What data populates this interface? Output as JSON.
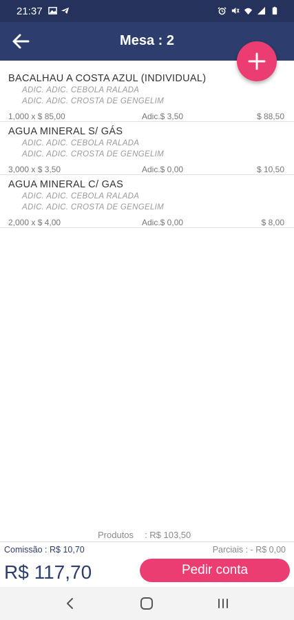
{
  "status_bar": {
    "time": "21:37",
    "left_icons": [
      "gallery-icon",
      "telegram-icon"
    ],
    "right_icons": [
      "alarm-icon",
      "mute-icon",
      "wifi-icon",
      "signal-icon",
      "battery-icon"
    ]
  },
  "app_bar": {
    "title": "Mesa : 2",
    "back_icon": "arrow-left-icon",
    "add_icon": "plus-icon"
  },
  "items": [
    {
      "name": "BACALHAU A COSTA AZUL (INDIVIDUAL)",
      "additions": [
        "ADIC. ADIC. CEBOLA RALADA",
        "ADIC. ADIC. CROSTA DE GENGELIM"
      ],
      "qty_price": "1,000 x $ 85,00",
      "adic": "Adic.$ 3,50",
      "total": "$ 88,50"
    },
    {
      "name": "AGUA MINERAL S/ GÁS",
      "additions": [
        "ADIC. ADIC. CEBOLA RALADA",
        "ADIC. ADIC. CROSTA DE GENGELIM"
      ],
      "qty_price": "3,000 x $ 3,50",
      "adic": "Adic.$ 0,00",
      "total": "$ 10,50"
    },
    {
      "name": "AGUA MINERAL C/ GAS",
      "additions": [
        "ADIC. ADIC. CEBOLA RALADA",
        "ADIC. ADIC. CROSTA DE GENGELIM"
      ],
      "qty_price": "2,000 x $ 4,00",
      "adic": "Adic.$ 0,00",
      "total": "$ 8,00"
    }
  ],
  "summary": {
    "produtos_label": "Produtos",
    "produtos_value": ": R$ 103,50",
    "comissao": "Comissão  : R$ 10,70",
    "parciais": "Parciais : - R$ 0,00",
    "total": "R$ 117,70",
    "pedir_conta_label": "Pedir conta"
  },
  "nav_bar": {
    "icons": [
      "back-nav-icon",
      "home-nav-icon",
      "recents-nav-icon"
    ]
  },
  "colors": {
    "status_bar": "#24325c",
    "app_bar": "#2d3e6e",
    "accent": "#ec3d73",
    "total_text": "#2d3e6e"
  }
}
